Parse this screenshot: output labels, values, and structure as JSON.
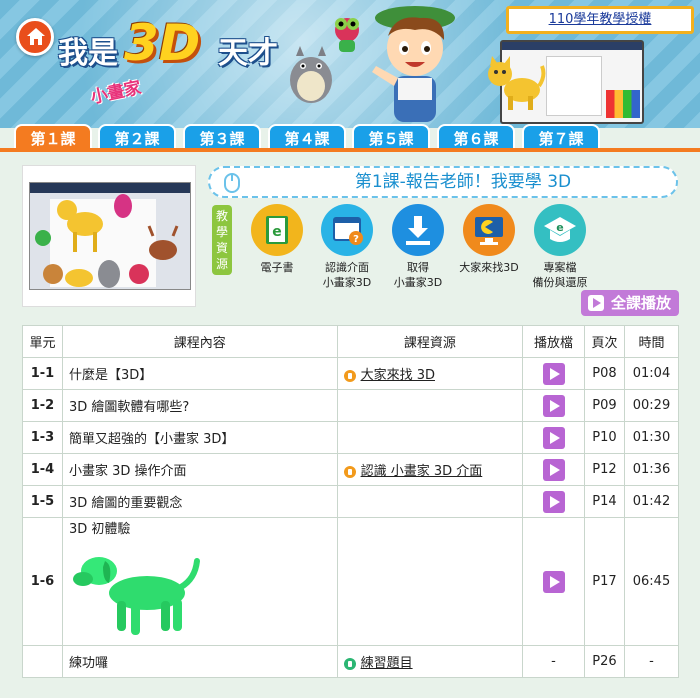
{
  "header": {
    "logo_part1": "我是",
    "logo_3d": "3D",
    "logo_part2": "天才",
    "logo_sub": "小畫家",
    "license": "110學年教學授權"
  },
  "tabs": [
    {
      "label": "第１課",
      "active": true
    },
    {
      "label": "第２課",
      "active": false
    },
    {
      "label": "第３課",
      "active": false
    },
    {
      "label": "第４課",
      "active": false
    },
    {
      "label": "第５課",
      "active": false
    },
    {
      "label": "第６課",
      "active": false
    },
    {
      "label": "第７課",
      "active": false
    }
  ],
  "lesson": {
    "title": "第1課-報告老師！我要學 3D",
    "resource_label": "教學資源",
    "resources": [
      {
        "line1": "電子書",
        "line2": "",
        "icon": "ebook-icon",
        "color": "#f2b51c"
      },
      {
        "line1": "認識介面",
        "line2": "小畫家3D",
        "icon": "interface-icon",
        "color": "#29b3e6"
      },
      {
        "line1": "取得",
        "line2": "小畫家3D",
        "icon": "download-icon",
        "color": "#1e8fe0"
      },
      {
        "line1": "大家來找3D",
        "line2": "",
        "icon": "pacman-screen-icon",
        "color": "#f08a1c"
      },
      {
        "line1": "專案檔",
        "line2": "備份與還原",
        "icon": "project-file-icon",
        "color": "#34bfc2"
      }
    ],
    "play_all": "全課播放"
  },
  "table": {
    "headers": [
      "單元",
      "課程內容",
      "課程資源",
      "播放檔",
      "頁次",
      "時間"
    ],
    "rows": [
      {
        "unit": "1-1",
        "content": "什麼是【3D】",
        "resource": "大家來找 3D",
        "res_color": "orange",
        "has_play": true,
        "page": "P08",
        "time": "01:04"
      },
      {
        "unit": "1-2",
        "content": "3D 繪圖軟體有哪些?",
        "resource": "",
        "res_color": "",
        "has_play": true,
        "page": "P09",
        "time": "00:29"
      },
      {
        "unit": "1-3",
        "content": "簡單又超強的【小畫家 3D】",
        "resource": "",
        "res_color": "",
        "has_play": true,
        "page": "P10",
        "time": "01:30"
      },
      {
        "unit": "1-4",
        "content": "小畫家 3D 操作介面",
        "resource": "認識 小畫家 3D 介面",
        "res_color": "orange",
        "has_play": true,
        "page": "P12",
        "time": "01:36"
      },
      {
        "unit": "1-5",
        "content": "3D 繪圖的重要觀念",
        "resource": "",
        "res_color": "",
        "has_play": true,
        "page": "P14",
        "time": "01:42"
      },
      {
        "unit": "1-6",
        "content": "3D 初體驗",
        "resource": "",
        "res_color": "",
        "has_play": true,
        "page": "P17",
        "time": "06:45",
        "image": "green-3d-dog"
      },
      {
        "unit": "",
        "content": "練功囉",
        "resource": "練習題目",
        "res_color": "green",
        "has_play": false,
        "play_text": "-",
        "page": "P26",
        "time": "-"
      }
    ]
  }
}
